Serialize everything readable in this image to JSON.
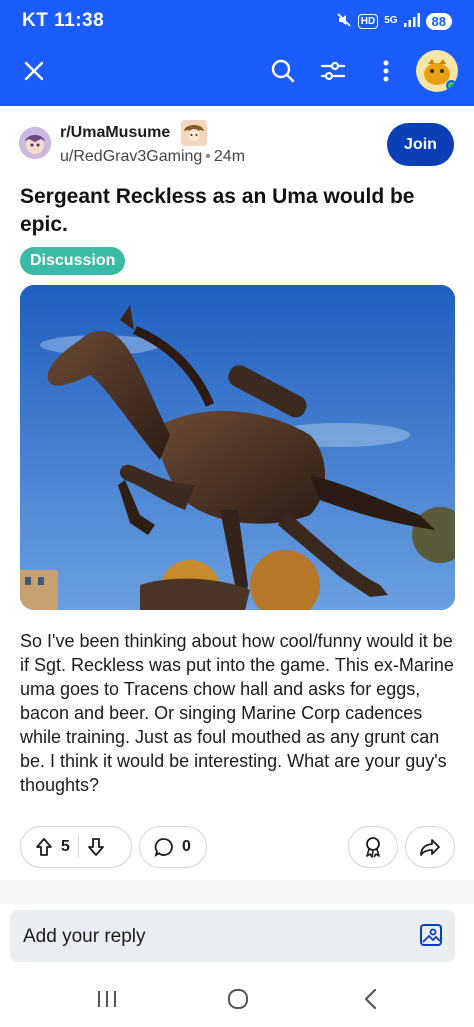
{
  "status_bar": {
    "time": "KT 11:38",
    "hd_label": "HD",
    "network_label": "5G",
    "battery": "88",
    "icons": [
      "mute-icon",
      "signal-icon"
    ]
  },
  "app_bar": {
    "icons": [
      "close-icon",
      "search-icon",
      "filter-icon",
      "more-icon",
      "profile-avatar"
    ]
  },
  "post": {
    "subreddit": "r/UmaMusume",
    "author": "u/RedGrav3Gaming",
    "separator": "•",
    "age": "24m",
    "join_label": "Join",
    "title": "Sergeant Reckless as an Uma would be epic.",
    "flair": "Discussion",
    "image_alt_icon": "horse-statue-image",
    "body": "So I've been thinking about how cool/funny would it be if Sgt. Reckless was put into the game. This ex-Marine uma goes to Tracens chow hall and asks for eggs, bacon and beer. Or singing Marine Corp cadences while training. Just as foul mouthed as any grunt can be. I think it would be interesting. What are your guy's thoughts?",
    "votes": "5",
    "comments": "0"
  },
  "reply": {
    "placeholder": "Add your reply"
  },
  "colors": {
    "header_blue": "#1a5cff",
    "join_blue": "#0b3fb5",
    "flair_teal": "#3bbba6"
  }
}
